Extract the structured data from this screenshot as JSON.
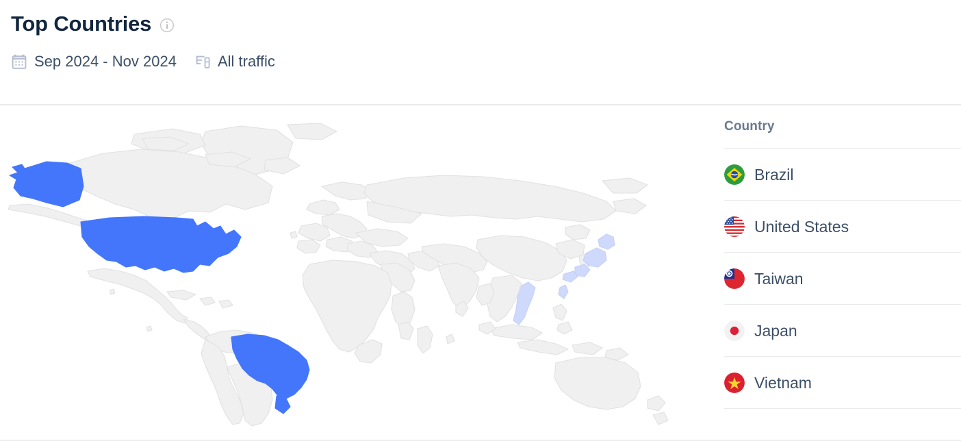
{
  "header": {
    "title": "Top Countries",
    "info_icon": "info-circle-icon",
    "date_range": "Sep 2024 - Nov 2024",
    "date_icon": "calendar-icon",
    "traffic_filter": "All traffic",
    "traffic_icon": "devices-icon"
  },
  "list": {
    "column_header": "Country",
    "rows": [
      {
        "name": "Brazil",
        "flag": "flag-brazil-icon"
      },
      {
        "name": "United States",
        "flag": "flag-united-states-icon"
      },
      {
        "name": "Taiwan",
        "flag": "flag-taiwan-icon"
      },
      {
        "name": "Japan",
        "flag": "flag-japan-icon"
      },
      {
        "name": "Vietnam",
        "flag": "flag-vietnam-icon"
      }
    ]
  },
  "map": {
    "highlight_color": "#4476FC",
    "land_color": "#F0F0F1",
    "border_color": "#E0E1E3",
    "highlighted_countries": [
      "United States",
      "Brazil",
      "Japan",
      "Taiwan",
      "Vietnam"
    ],
    "faint_countries": [
      "Japan",
      "Taiwan",
      "Vietnam"
    ]
  },
  "colors": {
    "title": "#12263F",
    "muted_text": "#3C4F66",
    "column_header": "#6B7A8E",
    "divider": "#E8EAED",
    "accent": "#4476FC"
  }
}
